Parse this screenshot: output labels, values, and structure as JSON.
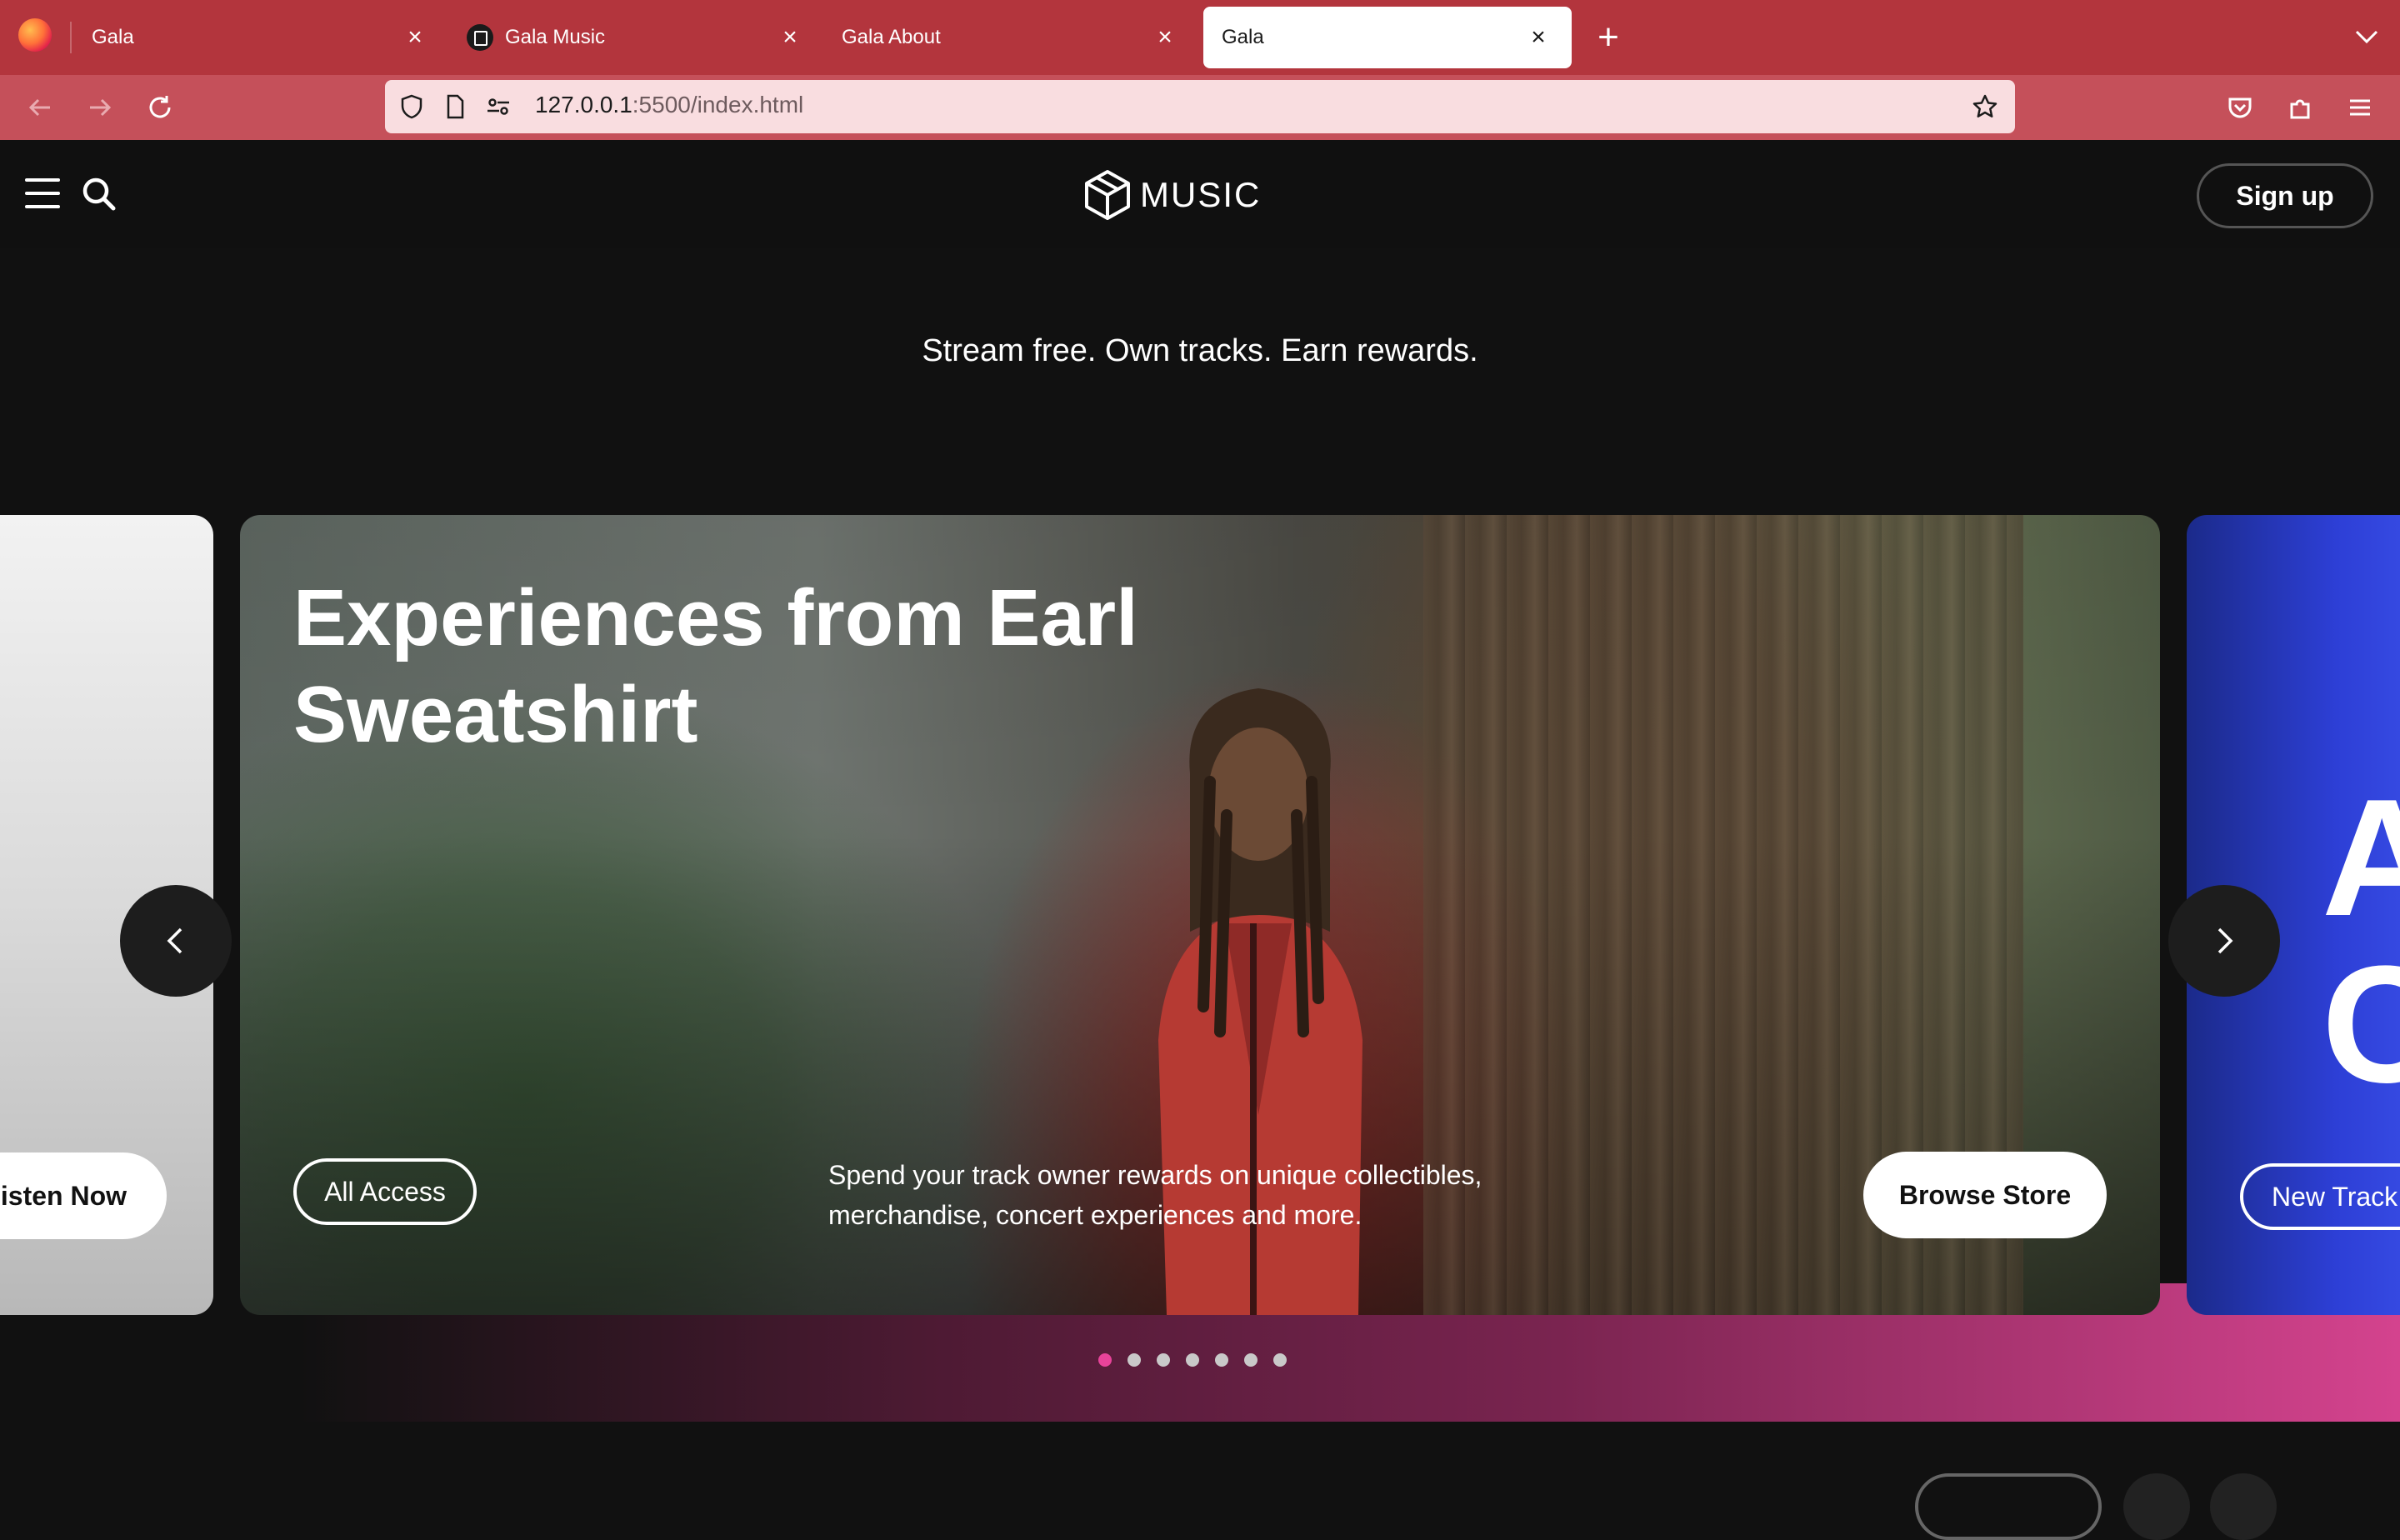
{
  "browser": {
    "tabs": [
      {
        "label": "Gala",
        "active": false,
        "favicon": "firefox-icon"
      },
      {
        "label": "Gala Music",
        "active": false,
        "favicon": "gala-icon"
      },
      {
        "label": "Gala About",
        "active": false,
        "favicon": ""
      },
      {
        "label": "Gala",
        "active": true,
        "favicon": ""
      }
    ],
    "url_host": "127.0.0.1",
    "url_rest": ":5500/index.html",
    "colors": {
      "tabbar": "#b3353d",
      "navbar": "#c5505a",
      "urlbar": "#f9dde0"
    }
  },
  "header": {
    "logo_text": "MUSIC",
    "signup_label": "Sign up"
  },
  "hero": {
    "tagline": "Stream free. Own tracks. Earn rewards.",
    "left_card": {
      "button_label": "isten Now"
    },
    "main_card": {
      "title": "Experiences from Earl Sweatshirt",
      "outline_button": "All Access",
      "description": "Spend your track owner rewards on unique collectibles, merchandise, concert experiences and more.",
      "cta_button": "Browse Store"
    },
    "right_card": {
      "button_label": "New Track",
      "partial_letters": "A\nC"
    },
    "carousel": {
      "total_slides": 7,
      "active_index": 0,
      "active_color": "#e8439a"
    }
  }
}
